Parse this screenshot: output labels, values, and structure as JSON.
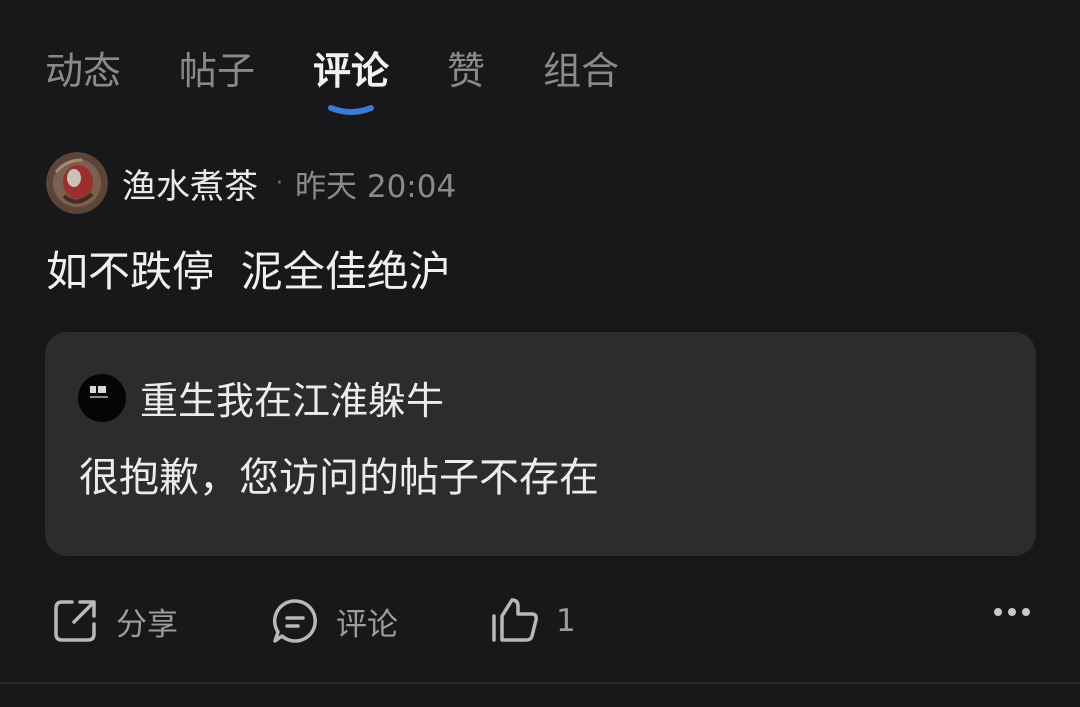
{
  "tabs": [
    {
      "label": "动态",
      "active": false
    },
    {
      "label": "帖子",
      "active": false
    },
    {
      "label": "评论",
      "active": true
    },
    {
      "label": "赞",
      "active": false
    },
    {
      "label": "组合",
      "active": false
    }
  ],
  "comment": {
    "author": "渔水煮茶",
    "separator": "·",
    "timestamp": "昨天 20:04",
    "text": "如不跌停  泥全佳绝沪"
  },
  "quoted_post": {
    "author": "重生我在江淮躲牛",
    "text": "很抱歉，您访问的帖子不存在"
  },
  "actions": {
    "share_label": "分享",
    "comment_label": "评论",
    "like_count": "1"
  },
  "colors": {
    "background": "#18181a",
    "card": "#2c2c2e",
    "accent": "#3a7bd5",
    "muted_text": "#8a8a8c"
  }
}
